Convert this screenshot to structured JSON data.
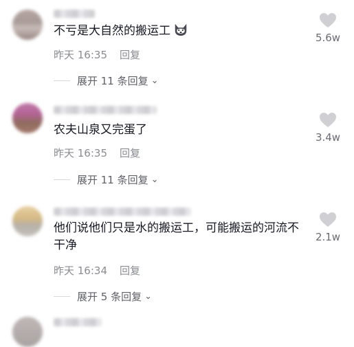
{
  "comments": [
    {
      "text": "不亏是大自然的搬运工",
      "time": "昨天 16:35",
      "reply_label": "回复",
      "expand_label": "展开 11 条回复",
      "likes": "5.6w",
      "emoji": "husky-emoji"
    },
    {
      "text": "农夫山泉又完蛋了",
      "time": "昨天 16:35",
      "reply_label": "回复",
      "expand_label": "展开 11 条回复",
      "likes": "3.4w"
    },
    {
      "text": "他们说他们只是水的搬运工，可能搬运的河流不干净",
      "time": "昨天 16:34",
      "reply_label": "回复",
      "expand_label": "展开 5 条回复",
      "likes": "2.1w"
    }
  ],
  "icons": {
    "like": "heart-icon",
    "expand": "chevron-down-icon"
  },
  "colors": {
    "text": "#161823",
    "meta": "#8a8b91",
    "heart": "#d0d0d4"
  }
}
